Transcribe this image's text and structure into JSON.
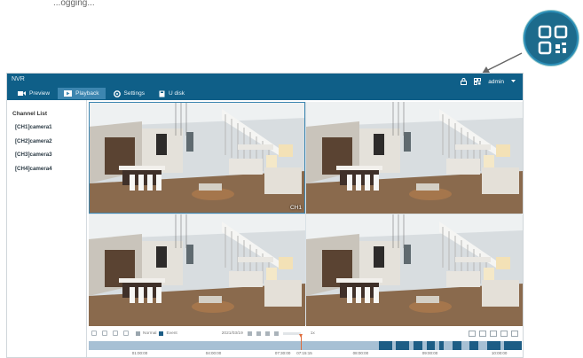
{
  "caption": "...ogging...",
  "app": {
    "title": "NVR",
    "tabs": [
      {
        "label": "Preview",
        "icon": "camera-icon",
        "active": false
      },
      {
        "label": "Playback",
        "icon": "playback-icon",
        "active": true
      },
      {
        "label": "Settings",
        "icon": "gear-icon",
        "active": false
      },
      {
        "label": "U disk",
        "icon": "usb-disk-icon",
        "active": false
      }
    ],
    "user": "admin"
  },
  "sidebar": {
    "title": "Channel List",
    "channels": [
      "[CH1]camera1",
      "[CH2]camera2",
      "[CH3]camera3",
      "[CH4]camera4"
    ]
  },
  "cameras": [
    {
      "label": "CH1",
      "selected": true
    },
    {
      "label": "",
      "selected": false
    },
    {
      "label": "",
      "selected": false
    },
    {
      "label": "",
      "selected": false
    }
  ],
  "controls": {
    "legend_normal": "Normal",
    "legend_event": "Event",
    "date": "2021/03/19",
    "speed": "1x"
  },
  "timeline": {
    "ticks": [
      "01:00:00",
      "04:00:00",
      "07:30:00",
      "07:15:15",
      "08:00:00",
      "09:00:00",
      "10:00:00"
    ],
    "cursor_fraction": 0.49,
    "event_segments": [
      [
        0.67,
        0.7
      ],
      [
        0.71,
        0.74
      ],
      [
        0.75,
        0.77
      ],
      [
        0.78,
        0.8
      ],
      [
        0.81,
        0.82
      ],
      [
        0.84,
        0.86
      ],
      [
        0.88,
        0.9
      ],
      [
        0.92,
        0.95
      ],
      [
        0.96,
        1.0
      ]
    ]
  },
  "colors": {
    "header": "#0f5f88",
    "active_tab": "#3d86b0",
    "event": "#1d5d85",
    "timeline": "#a7c0d4",
    "cursor": "#e06b3a"
  }
}
